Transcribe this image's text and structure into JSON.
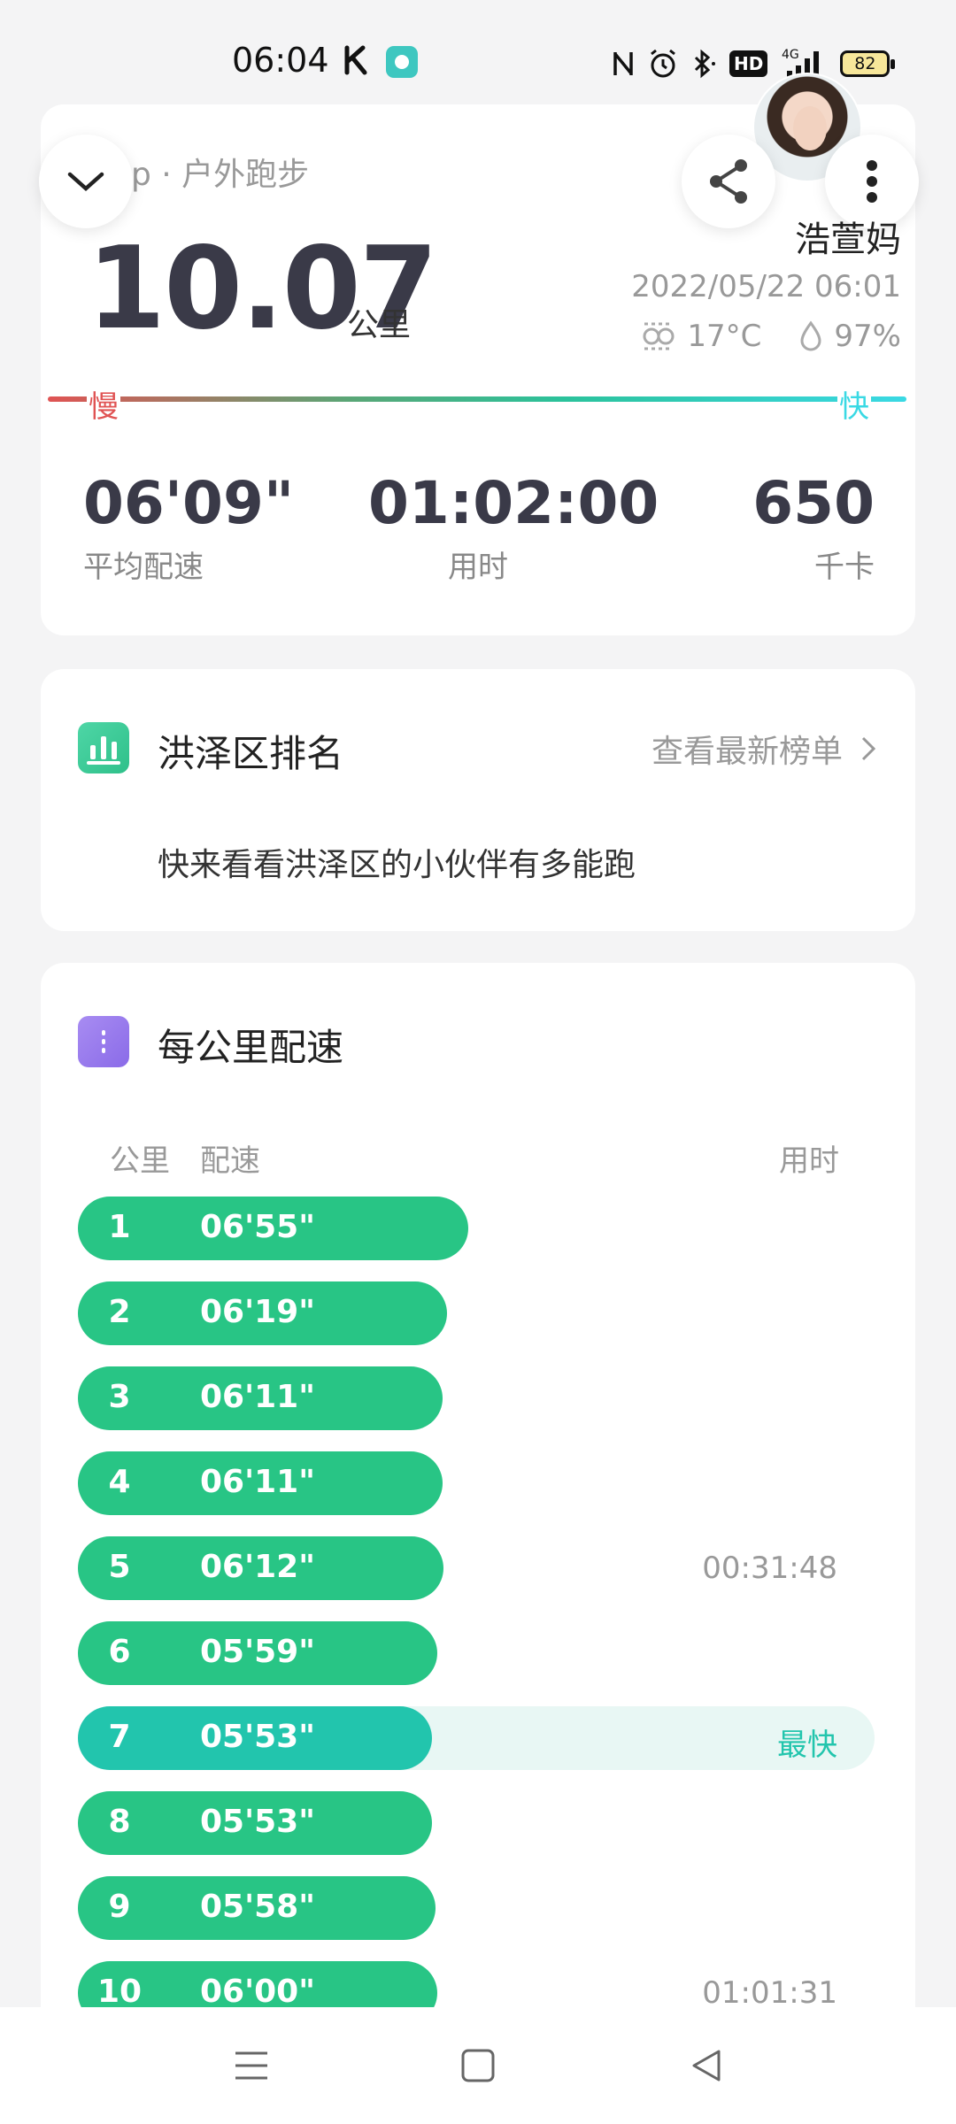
{
  "status_bar": {
    "time": "06:04",
    "hd_label": "HD",
    "network": "4G",
    "battery": "82"
  },
  "workout": {
    "title": "p · 户外跑步",
    "user_name": "浩萱妈",
    "distance": "10.07",
    "distance_unit": "公里",
    "datetime": "2022/05/22 06:01",
    "temperature": "17°C",
    "humidity": "97%",
    "slow_label": "慢",
    "fast_label": "快",
    "avg_pace": "06'09\"",
    "avg_pace_label": "平均配速",
    "duration": "01:02:00",
    "duration_label": "用时",
    "calories": "650",
    "calories_label": "千卡"
  },
  "ranking": {
    "title": "洪泽区排名",
    "link_label": "查看最新榜单",
    "description": "快来看看洪泽区的小伙伴有多能跑"
  },
  "pace_section": {
    "title": "每公里配速",
    "col_km": "公里",
    "col_pace": "配速",
    "col_time": "用时",
    "rows": [
      {
        "km": "1",
        "pace": "06'55\"",
        "time": "",
        "tag": "",
        "bar_fraction": 0.339
      },
      {
        "km": "2",
        "pace": "06'19\"",
        "time": "",
        "tag": "",
        "bar_fraction": 0.321
      },
      {
        "km": "3",
        "pace": "06'11\"",
        "time": "",
        "tag": "",
        "bar_fraction": 0.317
      },
      {
        "km": "4",
        "pace": "06'11\"",
        "time": "",
        "tag": "",
        "bar_fraction": 0.317
      },
      {
        "km": "5",
        "pace": "06'12\"",
        "time": "00:31:48",
        "tag": "",
        "bar_fraction": 0.318
      },
      {
        "km": "6",
        "pace": "05'59\"",
        "time": "",
        "tag": "",
        "bar_fraction": 0.312
      },
      {
        "km": "7",
        "pace": "05'53\"",
        "time": "",
        "tag": "最快",
        "bar_fraction": 0.308
      },
      {
        "km": "8",
        "pace": "05'53\"",
        "time": "",
        "tag": "",
        "bar_fraction": 0.308
      },
      {
        "km": "9",
        "pace": "05'58\"",
        "time": "",
        "tag": "",
        "bar_fraction": 0.311
      },
      {
        "km": "10",
        "pace": "06'00\"",
        "time": "01:01:31",
        "tag": "",
        "bar_fraction": 0.312
      }
    ]
  },
  "colors": {
    "bar_green": "#28c585",
    "bar_fastest": "#22c5ad",
    "slow": "#e05353",
    "fast": "#3ad9e4"
  },
  "icons": [
    "chevron-down-icon",
    "share-icon",
    "more-vert-icon",
    "weather-icon",
    "humidity-icon",
    "bar-chart-icon",
    "pace-icon",
    "chevron-right-icon",
    "menu-icon",
    "home-icon",
    "back-icon"
  ]
}
